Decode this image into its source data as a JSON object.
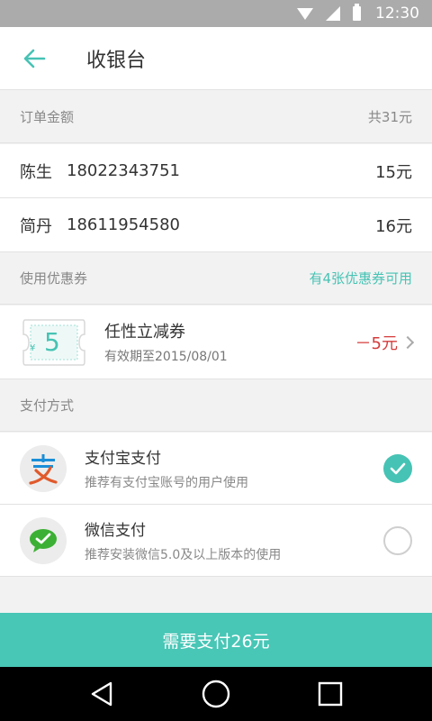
{
  "status_bar": {
    "time": "12:30"
  },
  "header": {
    "title": "收银台",
    "back_icon": "arrow-left-icon"
  },
  "order": {
    "label": "订单金额",
    "total": "共31元",
    "rows": [
      {
        "name": "陈生",
        "phone": "18022343751",
        "amount": "15元"
      },
      {
        "name": "简丹",
        "phone": "18611954580",
        "amount": "16元"
      }
    ]
  },
  "coupon": {
    "label": "使用优惠券",
    "available": "有4张优惠券可用",
    "item": {
      "currency": "¥",
      "face_value": "5",
      "title": "任性立减券",
      "expiry": "有效期至2015/08/01",
      "discount": "－5元"
    }
  },
  "payment": {
    "label": "支付方式",
    "methods": [
      {
        "title": "支付宝支付",
        "subtitle": "推荐有支付宝账号的用户使用",
        "icon": "alipay-icon",
        "selected": true
      },
      {
        "title": "微信支付",
        "subtitle": "推荐安装微信5.0及以上版本的使用",
        "icon": "wechat-icon",
        "selected": false
      }
    ]
  },
  "pay_button": {
    "label": "需要支付26元"
  },
  "colors": {
    "accent": "#48c6b6",
    "discount": "#d43b3b",
    "status_bar": "#ababab"
  }
}
